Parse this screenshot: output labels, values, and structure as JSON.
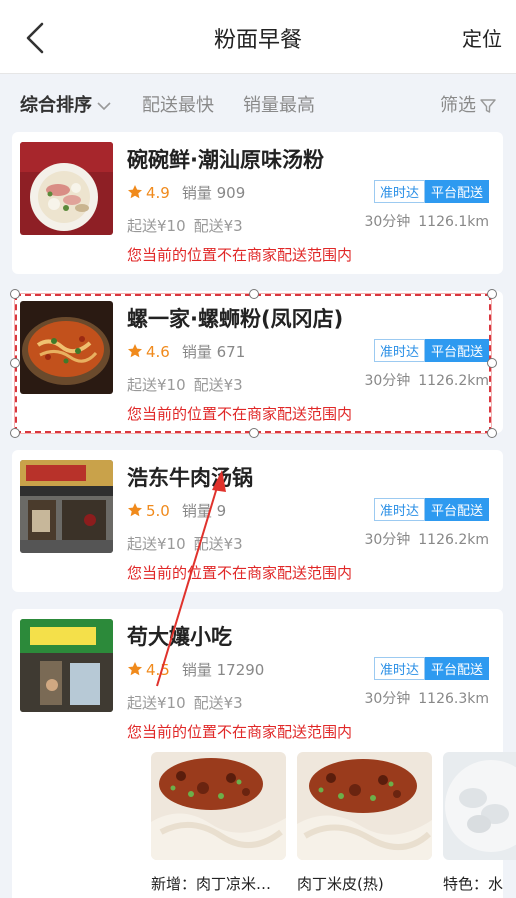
{
  "header": {
    "title": "粉面早餐",
    "locate_label": "定位",
    "back_icon": "chevron-left-icon"
  },
  "sortbar": {
    "sort_default": "综合排序",
    "sort_fast": "配送最快",
    "sort_sales": "销量最高",
    "filter_label": "筛选"
  },
  "colors": {
    "accent_blue": "#2e9af0",
    "rating_orange": "#f08a1c",
    "warning_red": "#e02828",
    "page_bg": "#f0f3f8"
  },
  "shops": [
    {
      "name": "碗碗鲜·潮汕原味汤粉",
      "rating": "4.9",
      "sales": "销量 909",
      "min_order": "起送¥10",
      "delivery_fee": "配送¥3",
      "time": "30分钟",
      "distance": "1126.1km",
      "badge_ontime": "准时达",
      "badge_platform": "平台配送",
      "warning": "您当前的位置不在商家配送范围内"
    },
    {
      "name": "螺一家·螺蛳粉(凤冈店)",
      "rating": "4.6",
      "sales": "销量 671",
      "min_order": "起送¥10",
      "delivery_fee": "配送¥3",
      "time": "30分钟",
      "distance": "1126.2km",
      "badge_ontime": "准时达",
      "badge_platform": "平台配送",
      "warning": "您当前的位置不在商家配送范围内"
    },
    {
      "name": "浩东牛肉汤锅",
      "rating": "5.0",
      "sales": "销量 9",
      "min_order": "起送¥10",
      "delivery_fee": "配送¥3",
      "time": "30分钟",
      "distance": "1126.2km",
      "badge_ontime": "准时达",
      "badge_platform": "平台配送",
      "warning": "您当前的位置不在商家配送范围内"
    },
    {
      "name": "苟大孃小吃",
      "rating": "4.5",
      "sales": "销量 17290",
      "min_order": "起送¥10",
      "delivery_fee": "配送¥3",
      "time": "30分钟",
      "distance": "1126.3km",
      "badge_ontime": "准时达",
      "badge_platform": "平台配送",
      "warning": "您当前的位置不在商家配送范围内",
      "dishes": [
        {
          "label": "新增：肉丁凉米…"
        },
        {
          "label": "肉丁米皮(热)"
        },
        {
          "label": "特色：水"
        }
      ]
    }
  ]
}
